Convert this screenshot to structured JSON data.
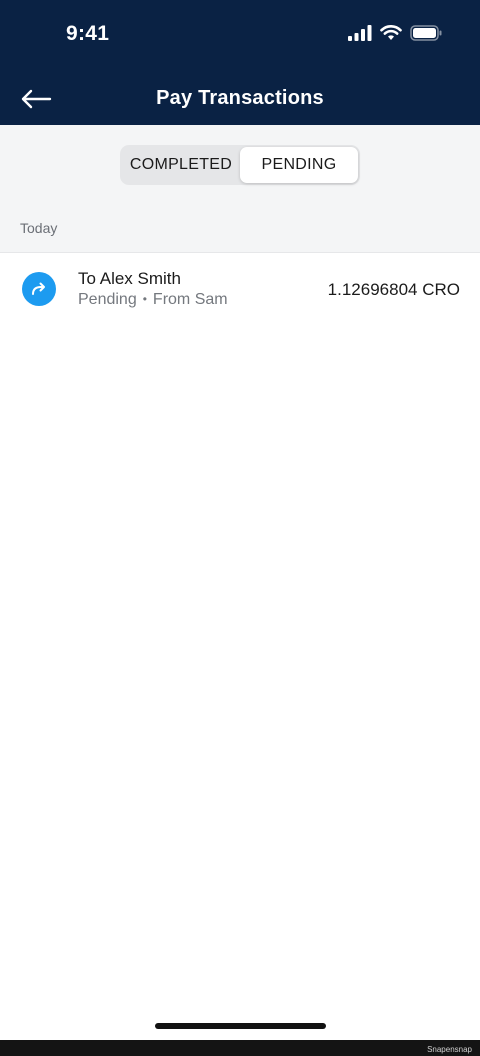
{
  "status_bar": {
    "time": "9:41",
    "icons": [
      "signal-icon",
      "wifi-icon",
      "battery-icon"
    ]
  },
  "nav": {
    "title": "Pay Transactions",
    "back_icon": "arrow-left-icon"
  },
  "tabs": [
    {
      "label": "COMPLETED",
      "active": false
    },
    {
      "label": "PENDING",
      "active": true
    }
  ],
  "sections": [
    {
      "header": "Today",
      "transactions": [
        {
          "icon": "send-arrow-icon",
          "title": "To Alex Smith",
          "status": "Pending",
          "separator": "•",
          "source": "From Sam",
          "amount": "1.12696804 CRO"
        }
      ]
    }
  ],
  "watermark": "Snapensnap",
  "colors": {
    "header_bg": "#0a2244",
    "accent": "#1d9bf0",
    "segment_bg": "#f4f5f6"
  }
}
